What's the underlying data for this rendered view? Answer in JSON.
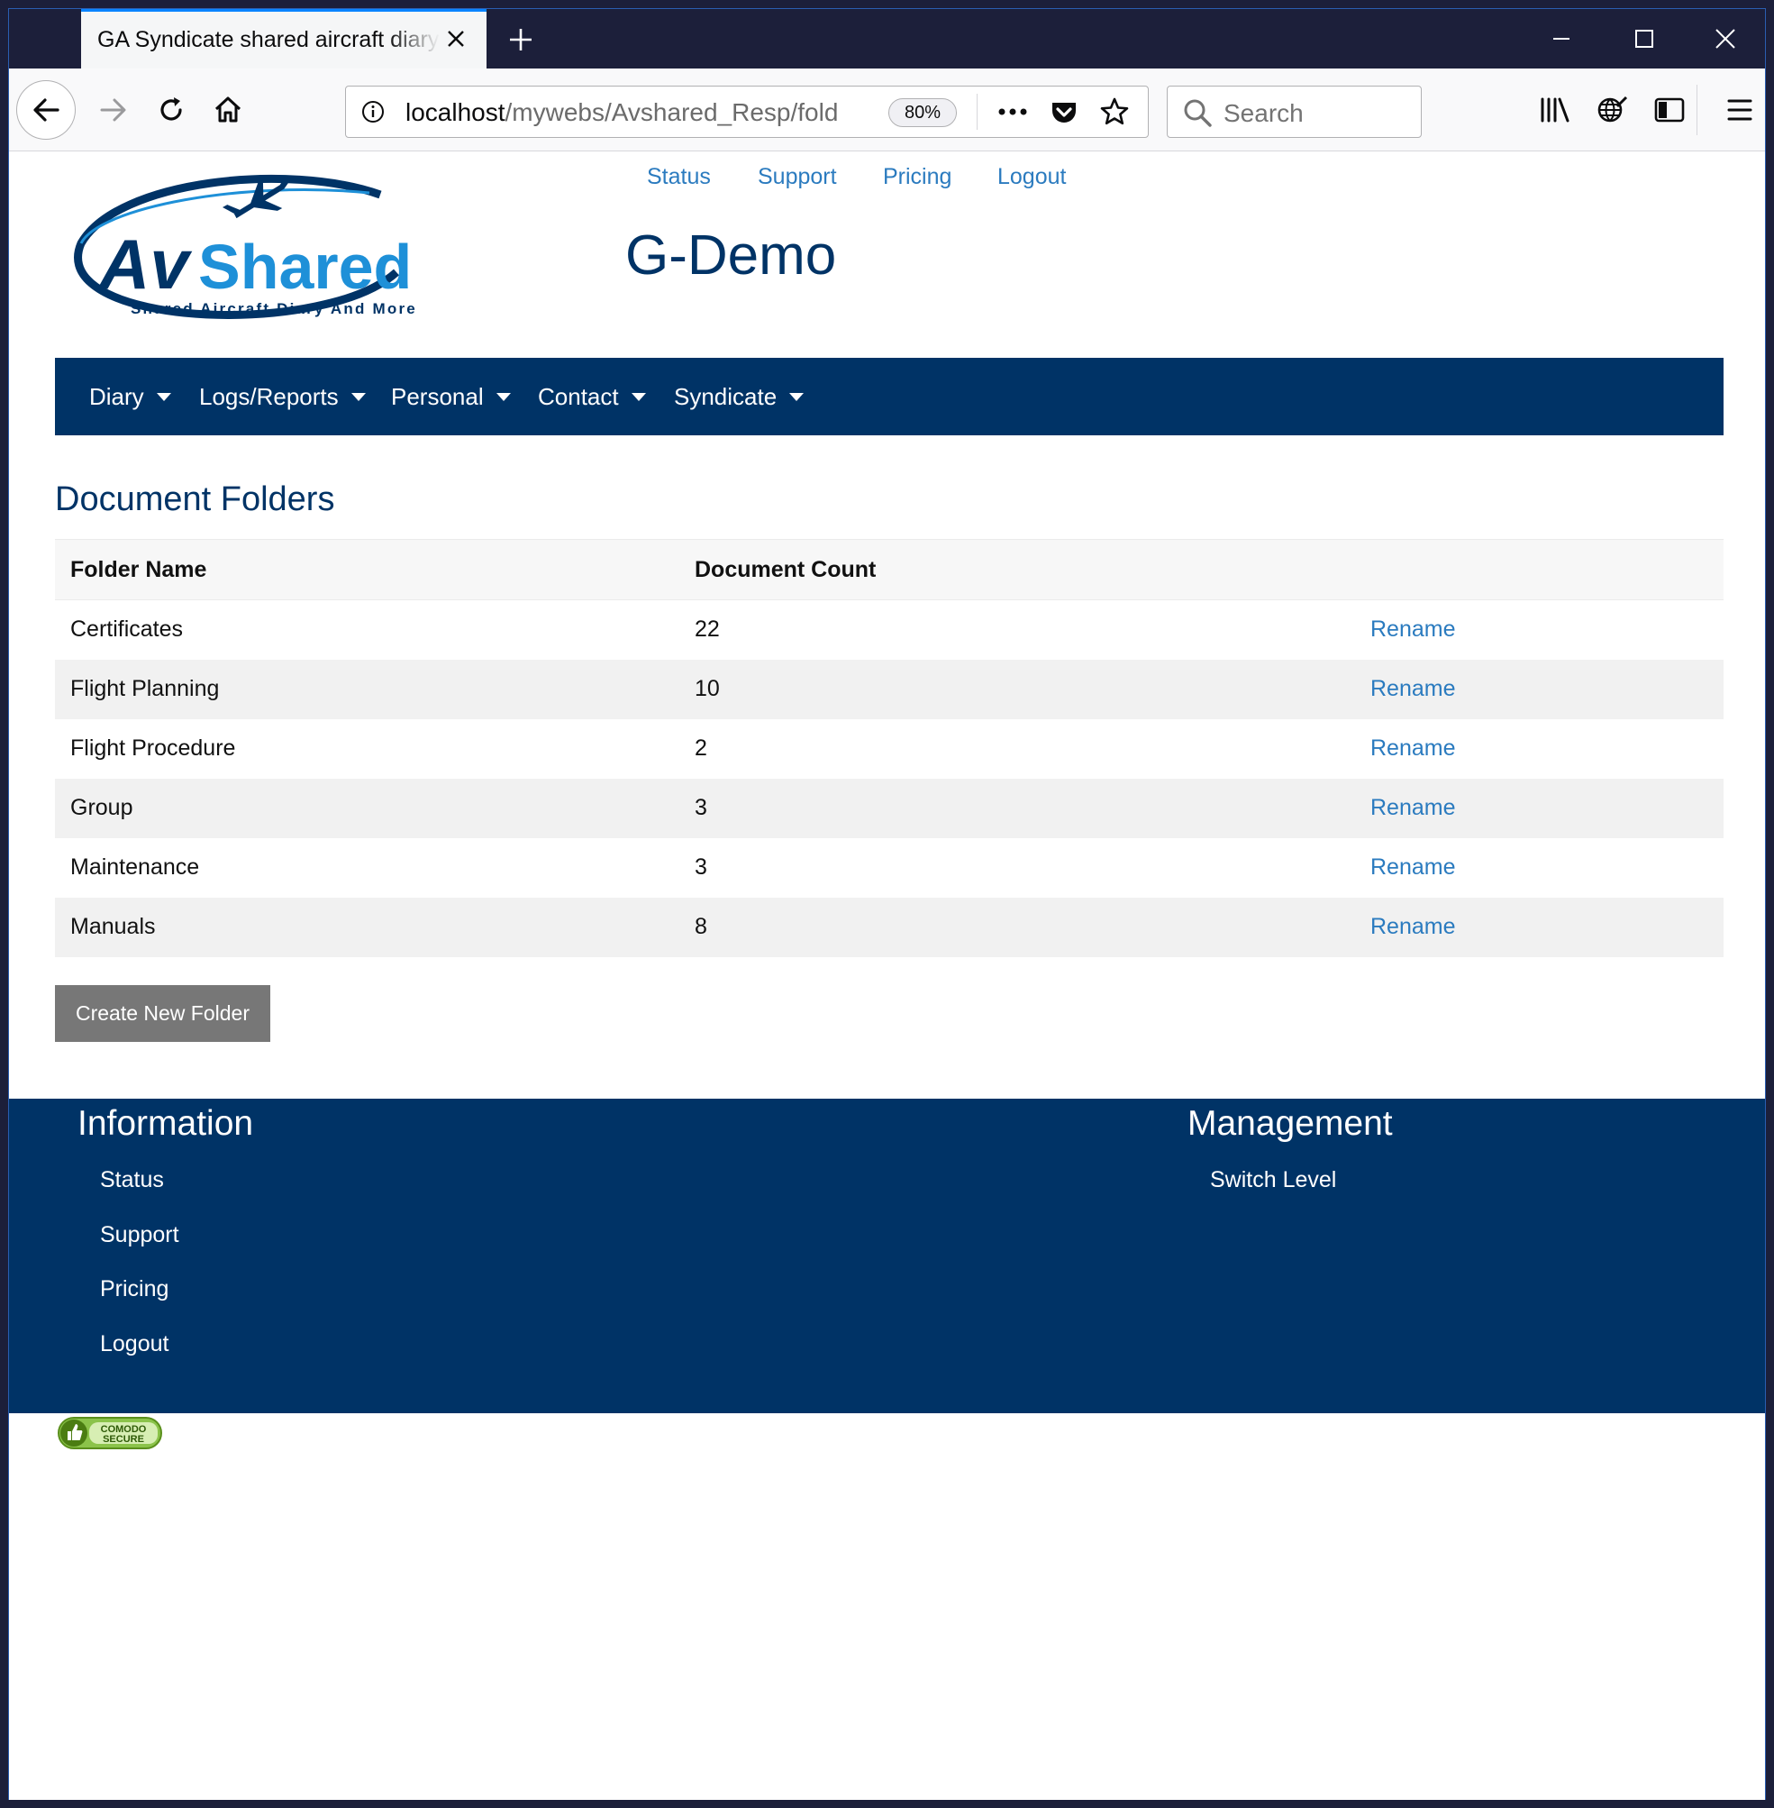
{
  "browser": {
    "tab_title": "GA Syndicate shared aircraft diary by",
    "url_host": "localhost",
    "url_path": "/mywebs/Avshared_Resp/fold",
    "zoom": "80%",
    "search_placeholder": "Search"
  },
  "header": {
    "logo_text": "AvShared",
    "logo_tagline": "Shared Aircraft Diary And More",
    "top_links": [
      "Status",
      "Support",
      "Pricing",
      "Logout"
    ],
    "site_title": "G-Demo"
  },
  "nav": {
    "items": [
      "Diary",
      "Logs/Reports",
      "Personal",
      "Contact",
      "Syndicate"
    ]
  },
  "main": {
    "section_title": "Document Folders",
    "table": {
      "headers": [
        "Folder Name",
        "Document Count",
        ""
      ],
      "rows": [
        {
          "name": "Certificates",
          "count": "22",
          "action": "Rename"
        },
        {
          "name": "Flight Planning",
          "count": "10",
          "action": "Rename"
        },
        {
          "name": "Flight Procedure",
          "count": "2",
          "action": "Rename"
        },
        {
          "name": "Group",
          "count": "3",
          "action": "Rename"
        },
        {
          "name": "Maintenance",
          "count": "3",
          "action": "Rename"
        },
        {
          "name": "Manuals",
          "count": "8",
          "action": "Rename"
        }
      ]
    },
    "create_button": "Create New Folder"
  },
  "footer": {
    "info_title": "Information",
    "info_links": [
      "Status",
      "Support",
      "Pricing",
      "Logout"
    ],
    "mgmt_title": "Management",
    "mgmt_links": [
      "Switch Level"
    ]
  },
  "badge": {
    "line1": "COMODO",
    "line2": "SECURE"
  },
  "colors": {
    "brand_navy": "#003366",
    "link_blue": "#2b7bbf",
    "button_grey": "#777777"
  }
}
